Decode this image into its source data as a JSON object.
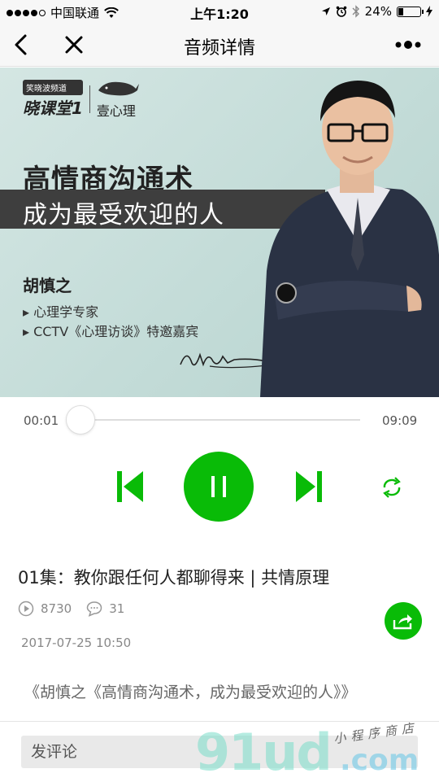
{
  "status": {
    "carrier": "中国联通",
    "time": "上午1:20",
    "battery": "24%",
    "battery_level": 0.24
  },
  "nav": {
    "title": "音频详情"
  },
  "banner": {
    "logo_badge": "笑晓波频道",
    "logo_main": "晓课堂1",
    "logo_sub": "壹心理",
    "title": "高情商沟通术",
    "subtitle": "成为最受欢迎的人",
    "name": "胡慎之",
    "bullets": [
      "心理学专家",
      "CCTV《心理访谈》特邀嘉宾"
    ]
  },
  "player": {
    "current_time": "00:01",
    "total_time": "09:09",
    "progress": 0.002
  },
  "episode": {
    "title": "01集：教你跟任何人都聊得来 | 共情原理",
    "plays": "8730",
    "comments": "31",
    "date": "2017-07-25 10:50"
  },
  "album": {
    "description": "《胡慎之《高情商沟通术，成为最受欢迎的人》》"
  },
  "comment": {
    "placeholder": "发评论"
  },
  "watermark": {
    "main": "91ud",
    "suffix": ".com",
    "tagline": "小程序商店"
  },
  "colors": {
    "accent": "#09bb07",
    "banner_bg": "#c8dedb"
  }
}
